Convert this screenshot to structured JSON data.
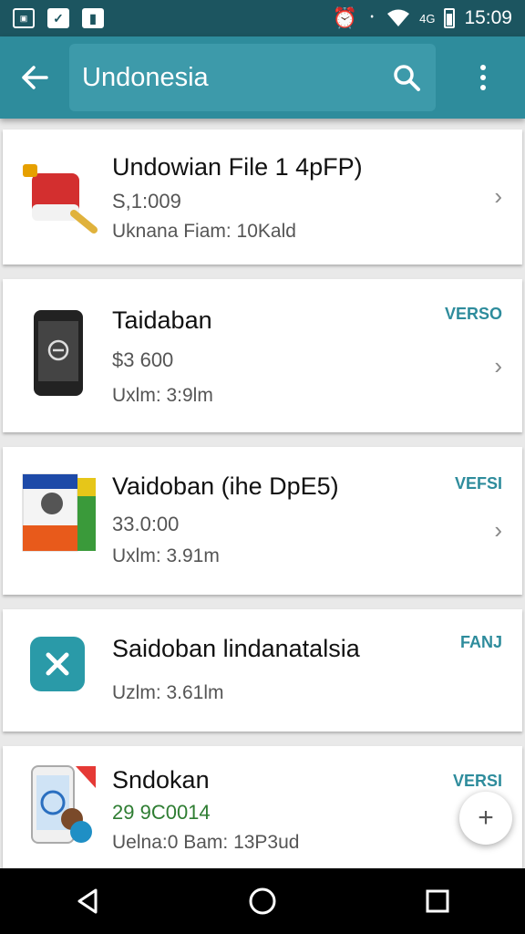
{
  "status_bar": {
    "time": "15:09",
    "network": "4G",
    "icons": [
      "gallery-icon",
      "checkbox-icon",
      "sim-icon",
      "alarm-icon",
      "bluetooth-icon",
      "wifi-icon",
      "signal-icon",
      "battery-icon"
    ]
  },
  "app_bar": {
    "title": "Undonesia",
    "icons": [
      "back-arrow-icon",
      "search-icon",
      "more-vert-icon"
    ],
    "accent_color": "#2e8c9c"
  },
  "items": [
    {
      "title": "Undowian File 1 4pFP)",
      "price": "S,1:009",
      "meta": "Uknana Fiam: 10Kald",
      "tag": "",
      "icon": "fire-extinguisher-icon"
    },
    {
      "title": "Taidaban",
      "price": "$3 600",
      "meta": "Uxlm: 3:9lm",
      "tag": "VERSO",
      "icon": "phone-icon"
    },
    {
      "title": "Vaidoban (ihe DpE5)",
      "price": "33.0:00",
      "meta": "Uxlm: 3.91m",
      "tag": "VEFSI",
      "icon": "software-box-icon"
    },
    {
      "title": "Saidoban lindanatalsia",
      "price": "",
      "meta": "Uzlm: 3.61lm",
      "tag": "FANJ",
      "icon": "close-app-icon"
    },
    {
      "title": "Sndokan",
      "price": "29 9C0014",
      "meta": "Uelna:0 Bam: 13P3ud",
      "tag": "VERSI",
      "icon": "phone-avatar-icon"
    }
  ],
  "fab": {
    "label": "+"
  },
  "nav": [
    "back-nav-icon",
    "home-nav-icon",
    "recents-nav-icon"
  ]
}
